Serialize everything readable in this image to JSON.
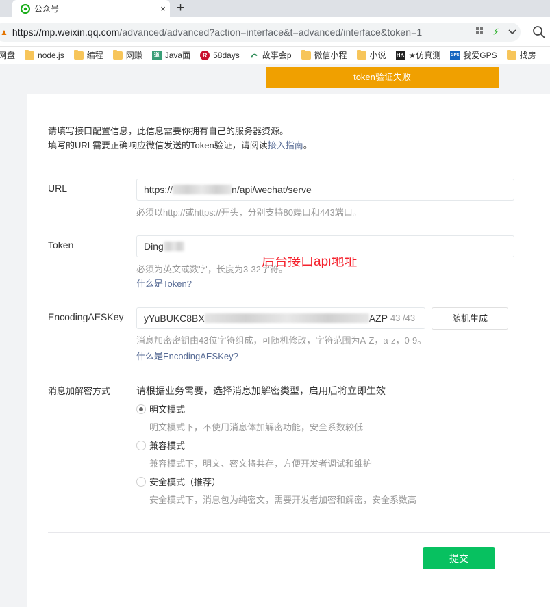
{
  "browser": {
    "tab_title": "公众号",
    "tab_close": "×",
    "new_tab": "+",
    "url_host": "https://mp.weixin.qq.com",
    "url_path": "/advanced/advanced?action=interface&t=advanced/interface&token=1",
    "bookmarks": [
      {
        "label": "网盘",
        "icon": "folder-icon"
      },
      {
        "label": "node.js",
        "icon": "folder-icon"
      },
      {
        "label": "编程",
        "icon": "folder-icon"
      },
      {
        "label": "网赚",
        "icon": "folder-icon"
      },
      {
        "label": "Java面",
        "icon": "java-site-icon"
      },
      {
        "label": "58days",
        "icon": "r-site-icon"
      },
      {
        "label": "故事会p",
        "icon": "story-site-icon"
      },
      {
        "label": "微信小程",
        "icon": "folder-icon"
      },
      {
        "label": "小说",
        "icon": "folder-icon"
      },
      {
        "label": "★仿真测",
        "icon": "hk-site-icon"
      },
      {
        "label": "我爱GPS",
        "icon": "gps-site-icon"
      },
      {
        "label": "找房",
        "icon": "folder-icon"
      }
    ],
    "bookmark_glyphs": {
      "java": "道",
      "r": "R",
      "hk": "HK",
      "gps": "GPS"
    }
  },
  "toast": {
    "text": "token验证失败",
    "color": "#f0a000"
  },
  "intro": {
    "line1": "请填写接口配置信息，此信息需要你拥有自己的服务器资源。",
    "line2_prefix": "填写的URL需要正确响应微信发送的Token验证，请阅读",
    "line2_link": "接入指南",
    "line2_suffix": "。"
  },
  "form": {
    "url": {
      "label": "URL",
      "value_prefix": "https://",
      "value_suffix": "n/api/wechat/serve",
      "hint": "必须以http://或https://开头，分别支持80端口和443端口。"
    },
    "annotation": "后台接口api地址",
    "token": {
      "label": "Token",
      "value_prefix": "Ding",
      "hint": "必须为英文或数字，长度为3-32字符。",
      "help_link": "什么是Token?"
    },
    "aes": {
      "label": "EncodingAESKey",
      "value_prefix": "yYuBUKC8BX",
      "value_suffix": "AZP",
      "count": "43 /43",
      "random_button": "随机生成",
      "hint": "消息加密密钥由43位字符组成，可随机修改，字符范围为A-Z，a-z，0-9。",
      "help_link": "什么是EncodingAESKey?"
    },
    "encryption": {
      "label": "消息加解密方式",
      "description": "请根据业务需要，选择消息加解密类型，启用后将立即生效",
      "options": [
        {
          "label": "明文模式",
          "desc": "明文模式下，不使用消息体加解密功能，安全系数较低",
          "checked": true
        },
        {
          "label": "兼容模式",
          "desc": "兼容模式下，明文、密文将共存，方便开发者调试和维护",
          "checked": false
        },
        {
          "label": "安全模式（推荐）",
          "desc": "安全模式下，消息包为纯密文，需要开发者加密和解密，安全系数高",
          "checked": false
        }
      ]
    },
    "submit": "提交"
  },
  "colors": {
    "brand_green": "#07c160",
    "link": "#576b95",
    "annotation_red": "#f5222d"
  }
}
